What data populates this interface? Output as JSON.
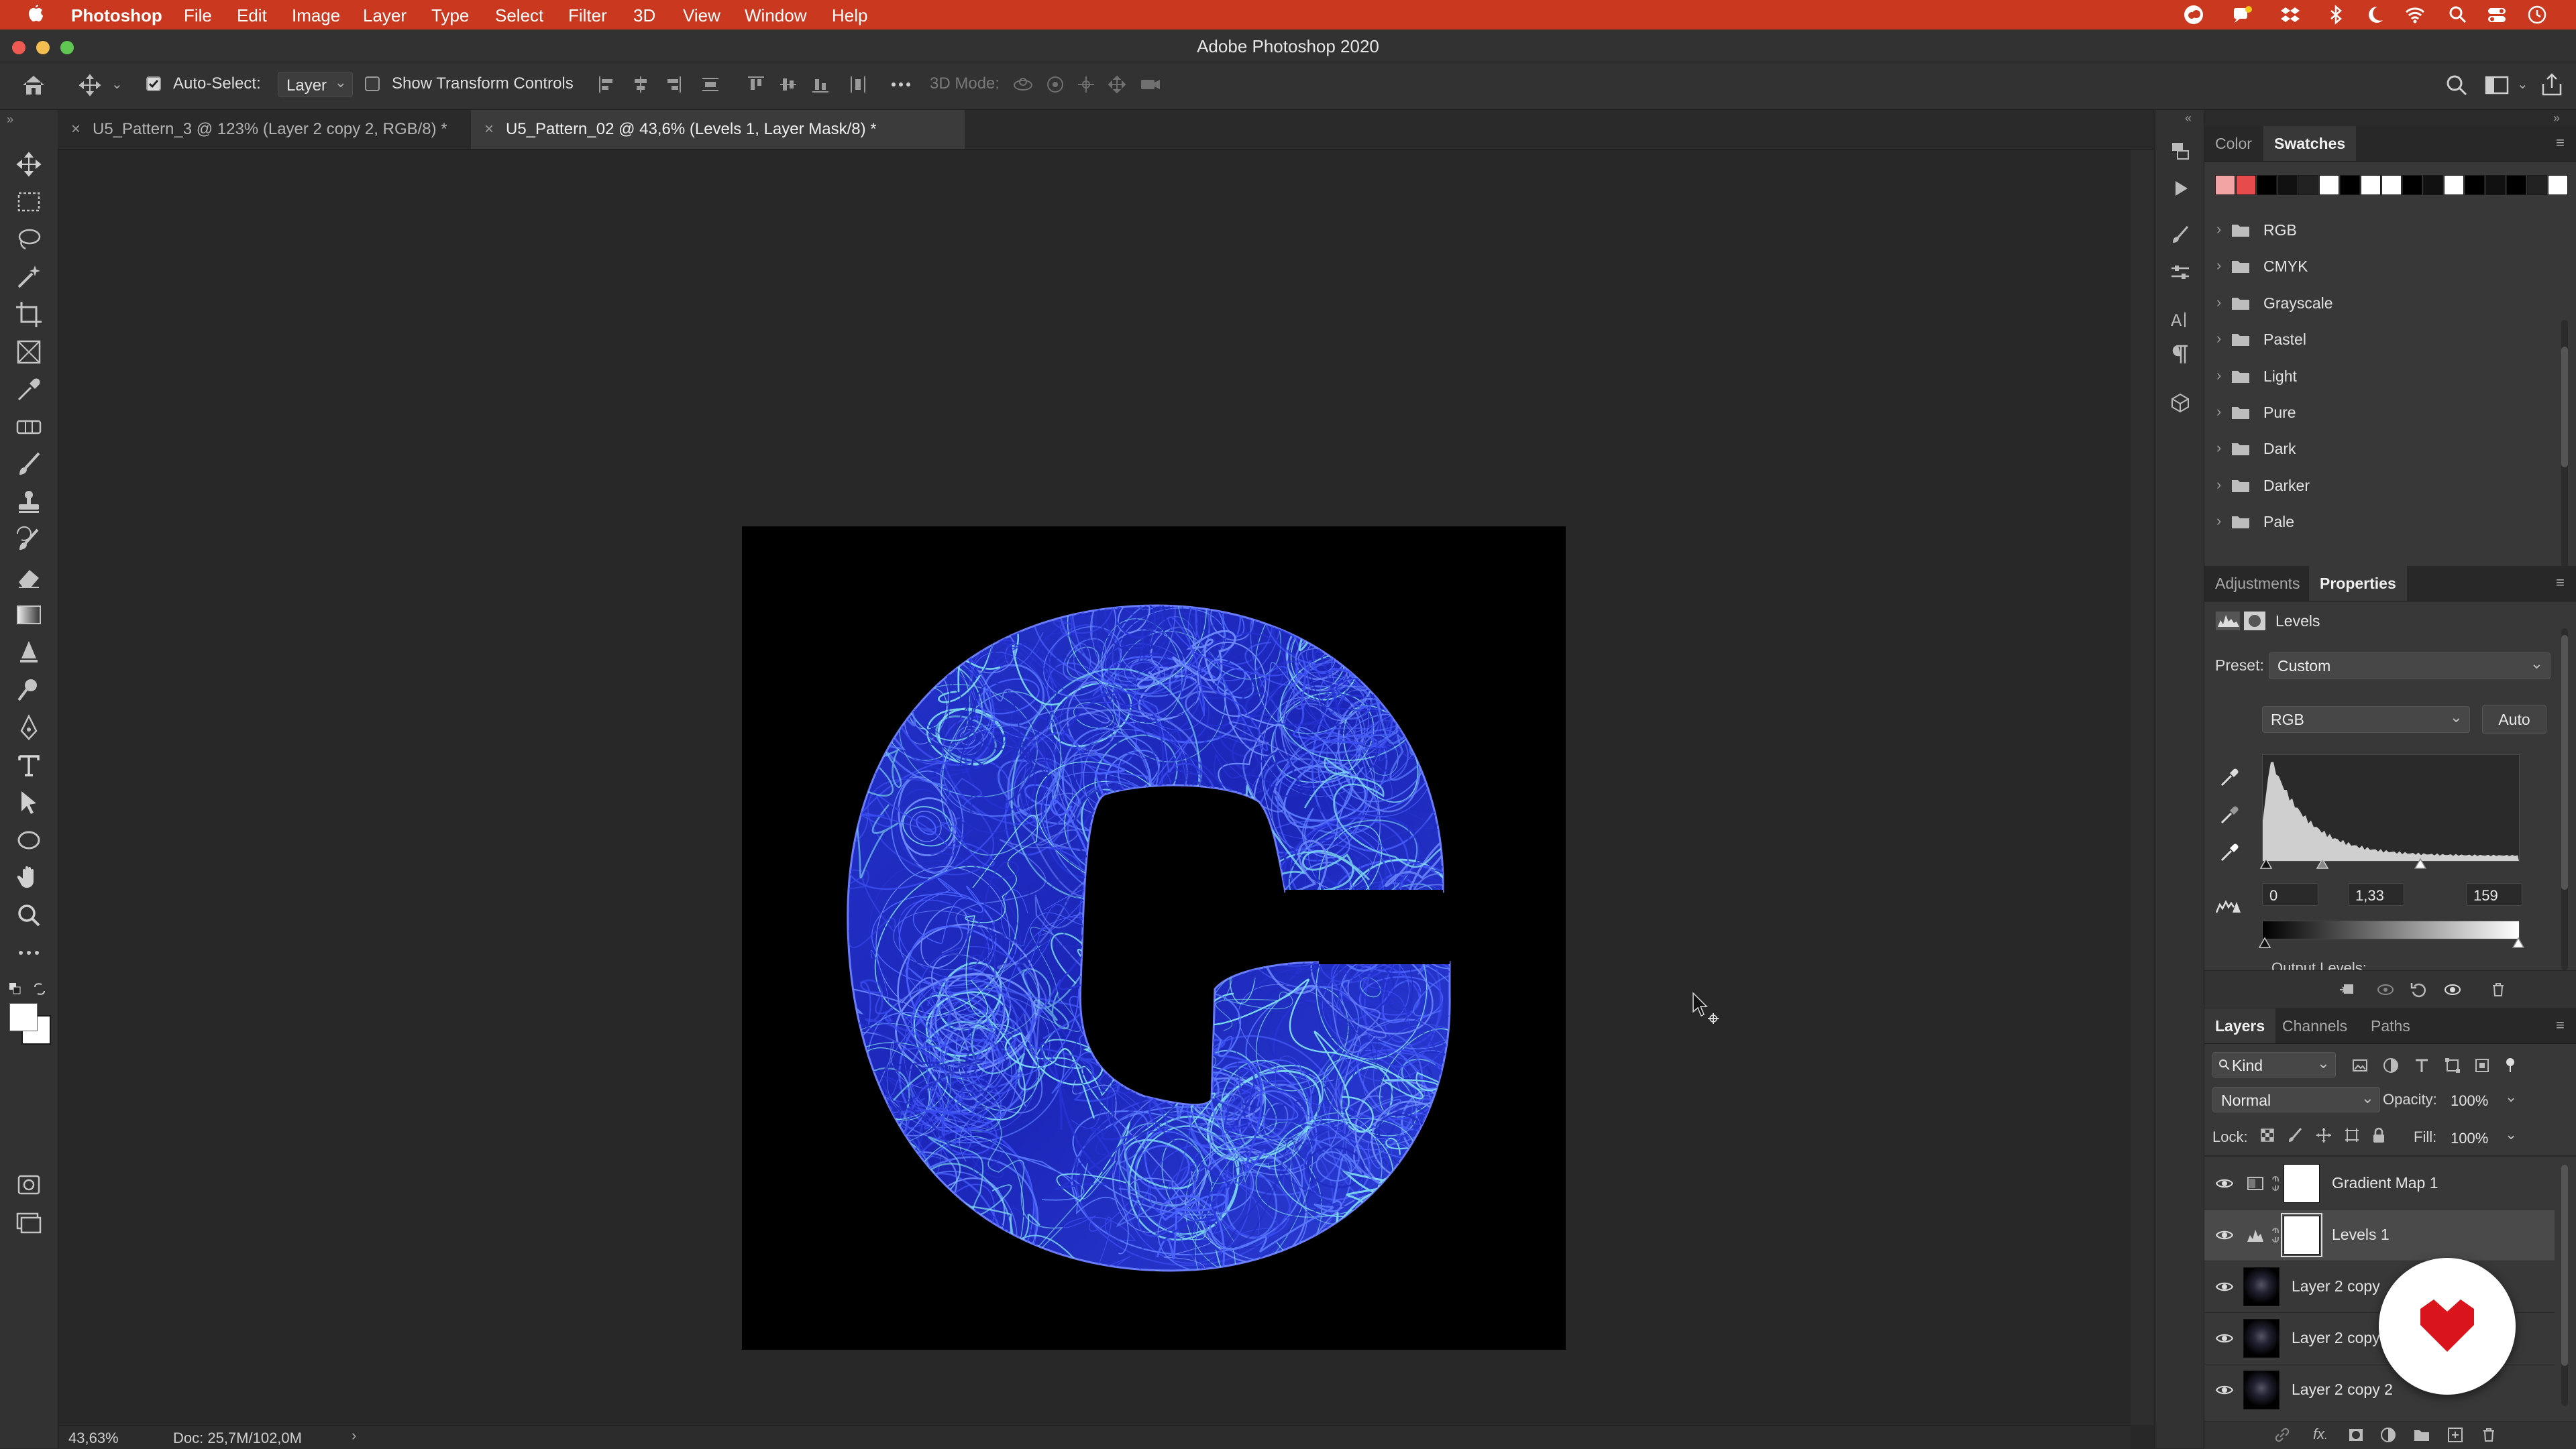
{
  "menubar": {
    "app_name": "Photoshop",
    "items": [
      "File",
      "Edit",
      "Image",
      "Layer",
      "Type",
      "Select",
      "Filter",
      "3D",
      "View",
      "Window",
      "Help"
    ],
    "brand_color": "#c9381f"
  },
  "window": {
    "title": "Adobe Photoshop 2020"
  },
  "options_bar": {
    "auto_select_label": "Auto-Select:",
    "auto_select_checked": true,
    "auto_select_target": "Layer",
    "show_transform_label": "Show Transform Controls",
    "show_transform_checked": false,
    "mode_3d_label": "3D Mode:"
  },
  "doc_tabs": [
    {
      "label": "U5_Pattern_3 @ 123% (Layer 2 copy 2, RGB/8) *",
      "active": false
    },
    {
      "label": "U5_Pattern_02 @ 43,6% (Levels 1, Layer Mask/8) *",
      "active": true
    }
  ],
  "tools": [
    "move-tool-icon",
    "marquee-tool-icon",
    "lasso-tool-icon",
    "magic-wand-tool-icon",
    "crop-tool-icon",
    "frame-tool-icon",
    "eyedropper-tool-icon",
    "healing-brush-tool-icon",
    "brush-tool-icon",
    "clone-stamp-tool-icon",
    "history-brush-tool-icon",
    "eraser-tool-icon",
    "gradient-tool-icon",
    "blur-tool-icon",
    "dodge-tool-icon",
    "pen-tool-icon",
    "type-tool-icon",
    "path-selection-tool-icon",
    "ellipse-tool-icon",
    "hand-tool-icon",
    "zoom-tool-icon",
    "more-tools-icon"
  ],
  "status": {
    "zoom": "43,63%",
    "doc_size": "Doc: 25,7M/102,0M"
  },
  "swatches_panel": {
    "tabs": [
      "Color",
      "Swatches"
    ],
    "active_tab": "Swatches",
    "recent_colors": [
      "#f2a4a4",
      "#e84b4b",
      "#000000",
      "#111111",
      "#222222",
      "#ffffff",
      "#000000",
      "#ffffff",
      "#ffffff",
      "#000000",
      "#111111",
      "#ffffff",
      "#000000",
      "#111111",
      "#000000",
      "#222222",
      "#ffffff"
    ],
    "groups": [
      "RGB",
      "CMYK",
      "Grayscale",
      "Pastel",
      "Light",
      "Pure",
      "Dark",
      "Darker",
      "Pale"
    ]
  },
  "properties_panel": {
    "tabs": [
      "Adjustments",
      "Properties"
    ],
    "active_tab": "Properties",
    "header": "Levels",
    "preset_label": "Preset:",
    "preset_value": "Custom",
    "channel": "RGB",
    "auto_label": "Auto",
    "input_black": "0",
    "input_gamma": "1,33",
    "input_white": "159",
    "output_label": "Output Levels:"
  },
  "layers_panel": {
    "tabs": [
      "Layers",
      "Channels",
      "Paths"
    ],
    "active_tab": "Layers",
    "filter_label": "Kind",
    "blend_mode": "Normal",
    "opacity_label": "Opacity:",
    "opacity_value": "100%",
    "lock_label": "Lock:",
    "fill_label": "Fill:",
    "fill_value": "100%",
    "layers": [
      {
        "name": "Gradient Map 1",
        "type": "adjustment",
        "selected": false
      },
      {
        "name": "Levels 1",
        "type": "adjustment",
        "selected": true
      },
      {
        "name": "Layer 2 copy",
        "type": "pixel",
        "selected": false
      },
      {
        "name": "Layer 2 copy",
        "type": "pixel",
        "selected": false
      },
      {
        "name": "Layer 2 copy 2",
        "type": "pixel",
        "selected": false
      }
    ]
  },
  "colors": {
    "swirl_dark": "#1a22c8",
    "swirl_light": "#7fdcf0",
    "badge": "#d9141d"
  }
}
